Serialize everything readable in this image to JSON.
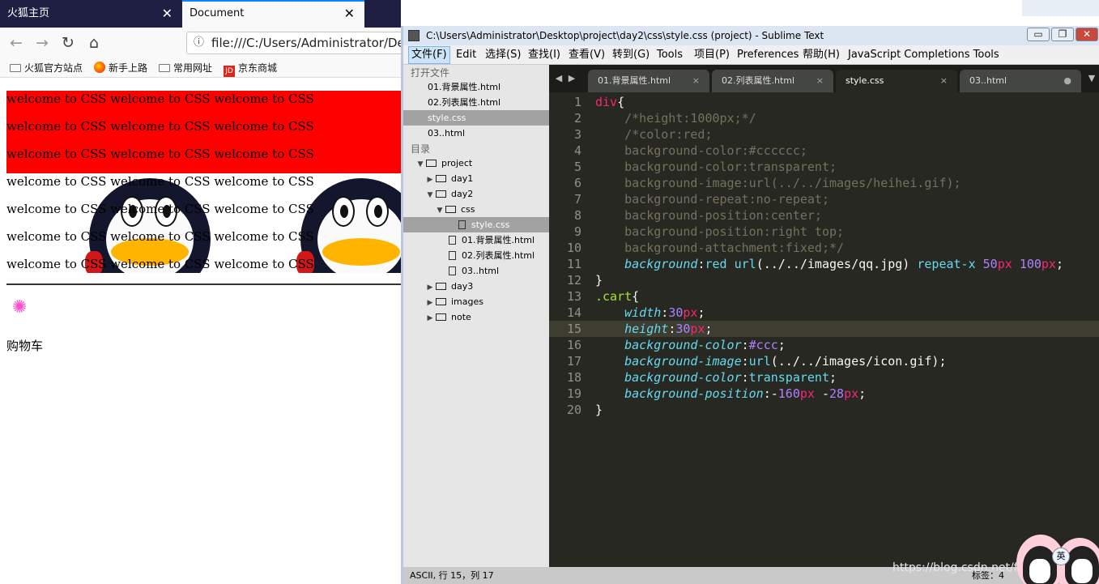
{
  "firefox": {
    "tabs": [
      {
        "label": "火狐主页",
        "close": "✕"
      },
      {
        "label": "Document",
        "close": "✕"
      }
    ],
    "nav": {
      "back": "←",
      "forward": "→",
      "reload": "↻",
      "home": "⌂",
      "info": "ⓘ"
    },
    "url": "file:///C:/Users/Administrator/Deskt",
    "bookmarks": [
      {
        "label": "火狐官方站点",
        "icon": "folder-icon"
      },
      {
        "label": "新手上路",
        "icon": "firefox-icon"
      },
      {
        "label": "常用网址",
        "icon": "folder-icon"
      },
      {
        "label": "京东商城",
        "icon": "jd-icon"
      }
    ],
    "jd_icon_text": "JD",
    "page": {
      "lines": [
        "welcome to CSS welcome to CSS welcome to CSS",
        "welcome to CSS welcome to CSS welcome to CSS",
        "welcome to CSS welcome to CSS welcome to CSS",
        "welcome to CSS welcome to CSS welcome to CSS",
        "welcome to CSS welcome to CSS welcome to CSS",
        "welcome to CSS welcome to CSS welcome to CSS",
        "welcome to CSS welcome to CSS welcome to CSS"
      ],
      "flower_glyph": "✺",
      "cart_text": "购物车"
    },
    "colors": {
      "band": "#ff0000",
      "tabbar": "#1e1f42",
      "accent": "#0a84ff"
    }
  },
  "sublime": {
    "title": "C:\\Users\\Administrator\\Desktop\\project\\day2\\css\\style.css (project) - Sublime Text",
    "window_buttons": [
      "▭",
      "❐",
      "✕"
    ],
    "menu": [
      "文件(F)",
      "Edit",
      "选择(S)",
      "查找(I)",
      "查看(V)",
      "转到(G)",
      "Tools",
      "项目(P)",
      "Preferences",
      "帮助(H)",
      "JavaScript Completions Tools"
    ],
    "sidebar": {
      "open_files_header": "打开文件",
      "open_files": [
        "01.背景属性.html",
        "02.列表属性.html",
        "style.css",
        "03..html"
      ],
      "folders_header": "目录",
      "tree": {
        "project": "project",
        "day1": "day1",
        "day2": "day2",
        "css": "css",
        "style": "style.css",
        "f1": "01.背景属性.html",
        "f2": "02.列表属性.html",
        "f3": "03..html",
        "day3": "day3",
        "images": "images",
        "note": "note"
      }
    },
    "tabs": [
      {
        "label": "01.背景属性.html",
        "close": "×"
      },
      {
        "label": "02.列表属性.html",
        "close": "×"
      },
      {
        "label": "style.css",
        "close": "×"
      },
      {
        "label": "03..html",
        "close": "●"
      }
    ],
    "tab_arrows": [
      "◀",
      "▶",
      "▼"
    ],
    "line_numbers": [
      "1",
      "2",
      "3",
      "4",
      "5",
      "6",
      "7",
      "8",
      "9",
      "10",
      "11",
      "12",
      "13",
      "14",
      "15",
      "16",
      "17",
      "18",
      "19",
      "20"
    ],
    "status": {
      "text": "ASCII, 行 15，列 17",
      "tab_size": "标签：4"
    },
    "watermark": "https://blog.csdn.net/fivrzrzaaaa",
    "avatar_badge": "英",
    "colors": {
      "bg": "#272822",
      "keyword": "#f92672",
      "comment": "#75715e",
      "property": "#66d9ef",
      "number": "#ae81ff"
    }
  }
}
